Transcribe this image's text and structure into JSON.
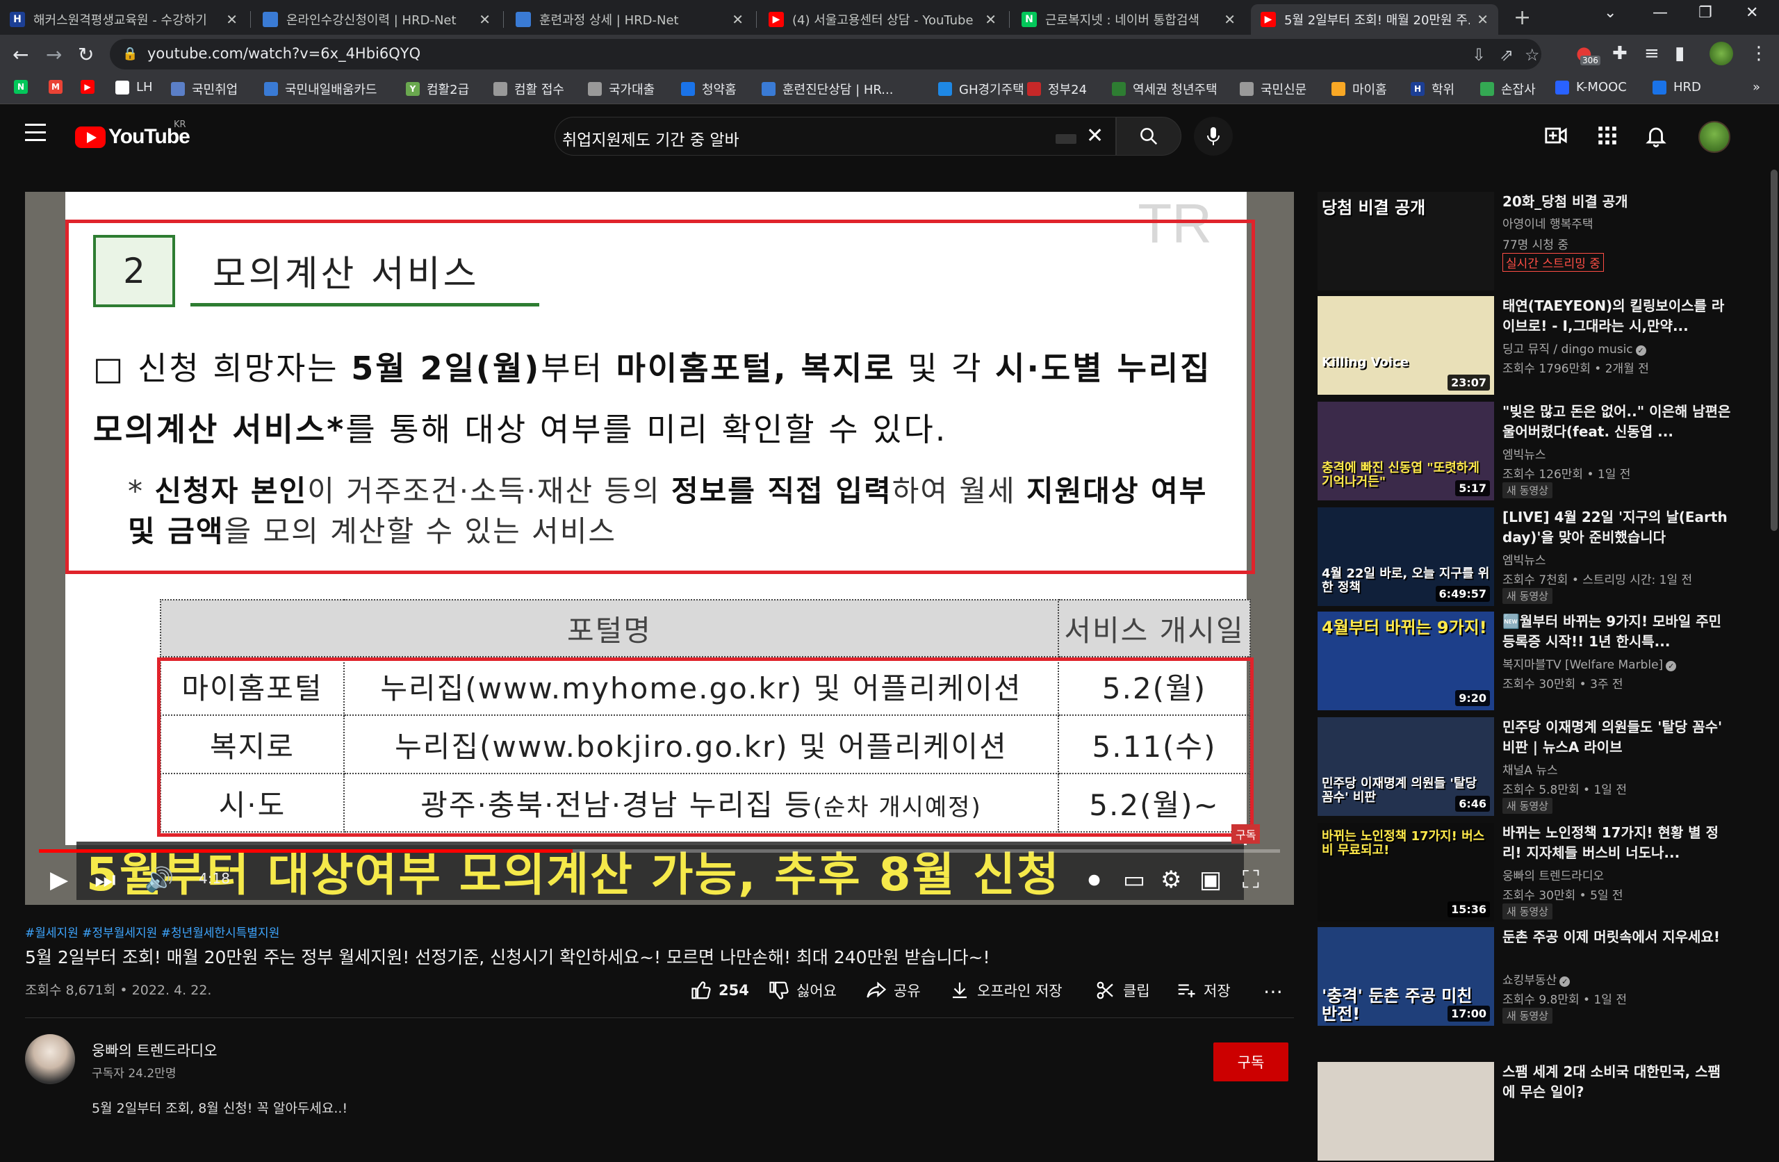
{
  "browser": {
    "tabs": [
      {
        "title": "해커스원격평생교육원 - 수강하기",
        "favicon_color": "#1c3f95",
        "favicon_text": "H"
      },
      {
        "title": "온라인수강신청이력 | HRD-Net",
        "favicon_color": "#3a7bd5",
        "favicon_text": ""
      },
      {
        "title": "훈련과정 상세 | HRD-Net",
        "favicon_color": "#3a7bd5",
        "favicon_text": ""
      },
      {
        "title": "(4) 서울고용센터 상담 - YouTube",
        "favicon_color": "#ff0000",
        "favicon_text": "▶"
      },
      {
        "title": "근로복지넷 : 네이버 통합검색",
        "favicon_color": "#03c75a",
        "favicon_text": "N"
      },
      {
        "title": "5월 2일부터 조회! 매월 20만원 주...",
        "favicon_color": "#ff0000",
        "favicon_text": "▶"
      }
    ],
    "active_tab_index": 5,
    "url": "youtube.com/watch?v=6x_4Hbi6QYQ",
    "extension_badge": "306",
    "bookmarks": [
      {
        "label": "",
        "color": "#03c75a",
        "text": "N"
      },
      {
        "label": "",
        "color": "#ea4335",
        "text": "M"
      },
      {
        "label": "",
        "color": "#ff0000",
        "text": "▶"
      },
      {
        "label": "LH",
        "color": "#ffffff",
        "text": ""
      },
      {
        "label": "국민취업",
        "color": "#5b7fc7",
        "text": ""
      },
      {
        "label": "국민내일배움카드",
        "color": "#3a7bd5",
        "text": ""
      },
      {
        "label": "컴활2급",
        "color": "#6aa84f",
        "text": "Y"
      },
      {
        "label": "컴활 접수",
        "color": "#999999",
        "text": ""
      },
      {
        "label": "국가대출",
        "color": "#999999",
        "text": ""
      },
      {
        "label": "청약홈",
        "color": "#1a73e8",
        "text": ""
      },
      {
        "label": "훈련진단상담 | HR...",
        "color": "#3a7bd5",
        "text": ""
      },
      {
        "label": "GH경기주택",
        "color": "#1e88e5",
        "text": ""
      },
      {
        "label": "정부24",
        "color": "#c62828",
        "text": ""
      },
      {
        "label": "역세권 청년주택",
        "color": "#2e7d32",
        "text": ""
      },
      {
        "label": "국민신문",
        "color": "#999999",
        "text": ""
      },
      {
        "label": "마이홈",
        "color": "#f9a825",
        "text": ""
      },
      {
        "label": "학위",
        "color": "#1c3f95",
        "text": "H"
      },
      {
        "label": "손잡사",
        "color": "#34a853",
        "text": ""
      },
      {
        "label": "K-MOOC",
        "color": "#2962ff",
        "text": ""
      },
      {
        "label": "HRD",
        "color": "#1a73e8",
        "text": ""
      }
    ]
  },
  "youtube": {
    "logo_text": "YouTube",
    "region": "KR",
    "search_query": "취업지원제도 기간 중 알바",
    "colors": {
      "brand": "#ff0000",
      "link": "#3ea6ff",
      "subscribe": "#cc0000"
    }
  },
  "slide": {
    "watermark": "TR",
    "section_number": "2",
    "section_title": "모의계산 서비스",
    "para_parts": [
      {
        "t": "□ 신청 희망자는 ",
        "b": false
      },
      {
        "t": "5월 2일(월)",
        "b": true
      },
      {
        "t": "부터 ",
        "b": false
      },
      {
        "t": "마이홈포털, 복지로",
        "b": true
      },
      {
        "t": " 및 각 ",
        "b": false
      },
      {
        "t": "시·도별 누리집 모의계산 서비스*",
        "b": true
      },
      {
        "t": "를 통해 대상 여부를 미리 확인할 수 있다.",
        "b": false
      }
    ],
    "note_parts": [
      {
        "t": "* ",
        "b": false
      },
      {
        "t": "신청자 본인",
        "b": true
      },
      {
        "t": "이 거주조건·소득·재산 등의 ",
        "b": false
      },
      {
        "t": "정보를 직접 입력",
        "b": true
      },
      {
        "t": "하여 월세 ",
        "b": false
      },
      {
        "t": "지원대상 여부 및 금액",
        "b": true
      },
      {
        "t": "을 모의 계산할 수 있는 서비스",
        "b": false
      }
    ],
    "table": {
      "headers": [
        "포털명",
        "서비스 개시일"
      ],
      "rows": [
        {
          "portal": "마이홈포털",
          "site": "누리집(www.myhome.go.kr) 및 어플리케이션",
          "site_note": "",
          "date": "5.2(월)"
        },
        {
          "portal": "복지로",
          "site": "누리집(www.bokjiro.go.kr) 및 어플리케이션",
          "site_note": "",
          "date": "5.11(수)"
        },
        {
          "portal": "시·도",
          "site": "광주·충북·전남·경남 누리집 등",
          "site_note": "(순차 개시예정)",
          "date": "5.2(월)~"
        }
      ]
    },
    "subtitle": "5월부터 대상여부 모의계산 가능, 추후 8월 신청",
    "subscribe_badge": "구독"
  },
  "player": {
    "progress": 0.43,
    "time": "4:18"
  },
  "video": {
    "hashtags": "#월세지원 #정부월세지원 #청년월세한시특별지원",
    "title": "5월 2일부터 조회! 매월 20만원 주는 정부 월세지원! 선정기준, 신청시기 확인하세요~! 모르면 나만손해! 최대 240만원 받습니다~!",
    "meta": "조회수 8,671회 • 2022. 4. 22.",
    "likes": "254",
    "dislike": "싫어요",
    "share": "공유",
    "offline": "오프라인 저장",
    "clip": "클립",
    "save": "저장",
    "channel": "웅빠의 트렌드라디오",
    "subscribers": "구독자 24.2만명",
    "subscribe": "구독",
    "description_peek": "5월 2일부터 조회, 8월 신청! 꼭 알아두세요..!"
  },
  "recommendations": [
    {
      "title": "20화_당첨 비결 공개",
      "channel": "아영이네 행복주택",
      "meta": "77명 시청 중",
      "badge": "",
      "live": "실시간 스트리밍 중",
      "duration": "",
      "thumb_bg": "#151515",
      "thumb_caption": "당첨 비결 공개",
      "caption_color": "#ffffff"
    },
    {
      "title": "태연(TAEYEON)의 킬링보이스를 라이브로! - I,그대라는 시,만약...",
      "channel": "딩고 뮤직 / dingo music",
      "verified": true,
      "meta": "조회수 1796만회 • 2개월 전",
      "badge": "",
      "live": "",
      "duration": "23:07",
      "thumb_bg": "#e9e0b8",
      "thumb_caption": "Killing Voice",
      "caption_color": "#ffffff"
    },
    {
      "title": "\"빚은 많고 돈은 없어..\" 이은해 남편은 울어버렸다(feat. 신동엽 ...",
      "channel": "엠빅뉴스",
      "verified": false,
      "meta": "조회수 126만회 • 1일 전",
      "badge": "새 동영상",
      "live": "",
      "duration": "5:17",
      "thumb_bg": "#3b2a4a",
      "thumb_caption": "충격에 빠진 신동엽 \"또렷하게 기억나거든\"",
      "caption_color": "#ffe94a"
    },
    {
      "title": "[LIVE] 4월 22일 '지구의 날(Earth day)'을 맞아 준비했습니다",
      "channel": "엠빅뉴스",
      "verified": false,
      "meta": "조회수 7천회 • 스트리밍 시간: 1일 전",
      "badge": "새 동영상",
      "live": "",
      "duration": "6:49:57",
      "thumb_bg": "#10203a",
      "thumb_caption": "4월 22일 바로, 오늘 지구를 위한 정책",
      "caption_color": "#ffffff"
    },
    {
      "title": "🆕월부터 바뀌는 9가지! 모바일 주민등록증 시작!! 1년 한시특...",
      "channel": "복지마블TV [Welfare Marble]",
      "verified": true,
      "meta": "조회수 30만회 • 3주 전",
      "badge": "",
      "live": "",
      "duration": "9:20",
      "thumb_bg": "#1d3f8a",
      "thumb_caption": "4월부터 바뀌는 9가지!",
      "caption_color": "#ffe94a"
    },
    {
      "title": "민주당 이재명계 의원들도 '탈당 꼼수' 비판 | 뉴스A 라이브",
      "channel": "채널A 뉴스",
      "verified": false,
      "meta": "조회수 5.8만회 • 1일 전",
      "badge": "새 동영상",
      "live": "",
      "duration": "6:46",
      "thumb_bg": "#23324f",
      "thumb_caption": "민주당 이재명계 의원들 '탈당 꼼수' 비판",
      "caption_color": "#ffffff"
    },
    {
      "title": "바뀌는 노인정책 17가지! 현황 별 정리! 지자체들 버스비 너도나...",
      "channel": "웅빠의 트렌드라디오",
      "verified": false,
      "meta": "조회수 30만회 • 5일 전",
      "badge": "새 동영상",
      "live": "",
      "duration": "15:36",
      "thumb_bg": "#0d0d0d",
      "thumb_caption": "바뀌는 노인정책 17가지! 버스비 무료되고!",
      "caption_color": "#ffe94a"
    },
    {
      "title": "둔촌 주공 이제 머릿속에서 지우세요!",
      "channel": "쇼킹부동산",
      "verified": true,
      "meta": "조회수 9.8만회 • 1일 전",
      "badge": "새 동영상",
      "live": "",
      "duration": "17:00",
      "thumb_bg": "#1f3f7a",
      "thumb_caption": "'충격' 둔촌 주공 미친 반전!",
      "caption_color": "#ffffff"
    },
    {
      "title": "스팸 세계 2대 소비국 대한민국, 스팸에 무슨 일이?",
      "channel": "",
      "verified": false,
      "meta": "",
      "badge": "",
      "live": "",
      "duration": "",
      "thumb_bg": "#d9d2c8",
      "thumb_caption": "",
      "caption_color": "#ffffff"
    }
  ]
}
